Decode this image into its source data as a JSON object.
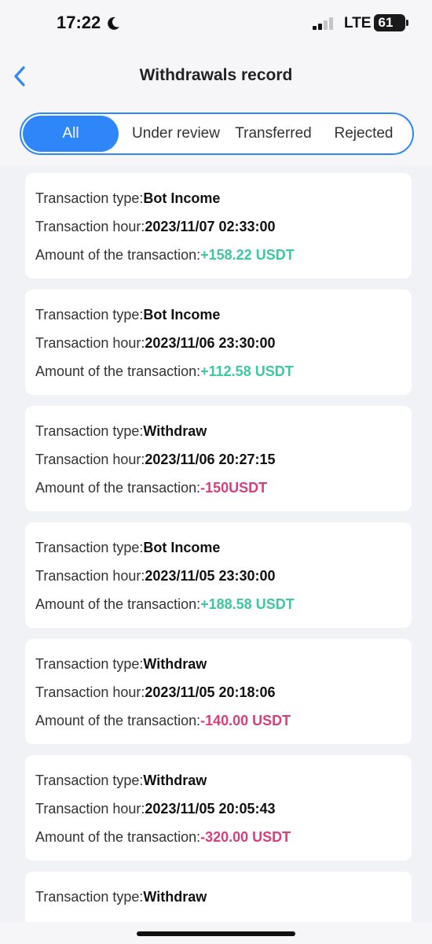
{
  "status_bar": {
    "time": "17:22",
    "network": "LTE",
    "battery": "61"
  },
  "header": {
    "title": "Withdrawals record"
  },
  "tabs": [
    {
      "label": "All",
      "active": true
    },
    {
      "label": "Under review",
      "active": false
    },
    {
      "label": "Transferred",
      "active": false
    },
    {
      "label": "Rejected",
      "active": false
    }
  ],
  "labels": {
    "type": "Transaction type:",
    "hour": "Transaction hour:",
    "amount": "Amount of the transaction:"
  },
  "transactions": [
    {
      "type": "Bot Income",
      "hour": "2023/11/07 02:33:00",
      "amount": "+158.22 USDT",
      "direction": "in"
    },
    {
      "type": "Bot Income",
      "hour": "2023/11/06 23:30:00",
      "amount": "+112.58 USDT",
      "direction": "in"
    },
    {
      "type": "Withdraw",
      "hour": "2023/11/06 20:27:15",
      "amount": "-150USDT",
      "direction": "out"
    },
    {
      "type": "Bot Income",
      "hour": "2023/11/05 23:30:00",
      "amount": "+188.58 USDT",
      "direction": "in"
    },
    {
      "type": "Withdraw",
      "hour": "2023/11/05 20:18:06",
      "amount": "-140.00 USDT",
      "direction": "out"
    },
    {
      "type": "Withdraw",
      "hour": "2023/11/05 20:05:43",
      "amount": "-320.00 USDT",
      "direction": "out"
    },
    {
      "type": "Withdraw",
      "hour": "",
      "amount": "",
      "direction": "out"
    }
  ],
  "colors": {
    "accent": "#2f86f8",
    "income": "#3cc8a0",
    "withdraw": "#d83f7e"
  },
  "icons": {
    "back": "chevron-left-icon",
    "do_not_disturb": "moon-icon",
    "signal": "signal-icon",
    "battery": "battery-icon"
  }
}
